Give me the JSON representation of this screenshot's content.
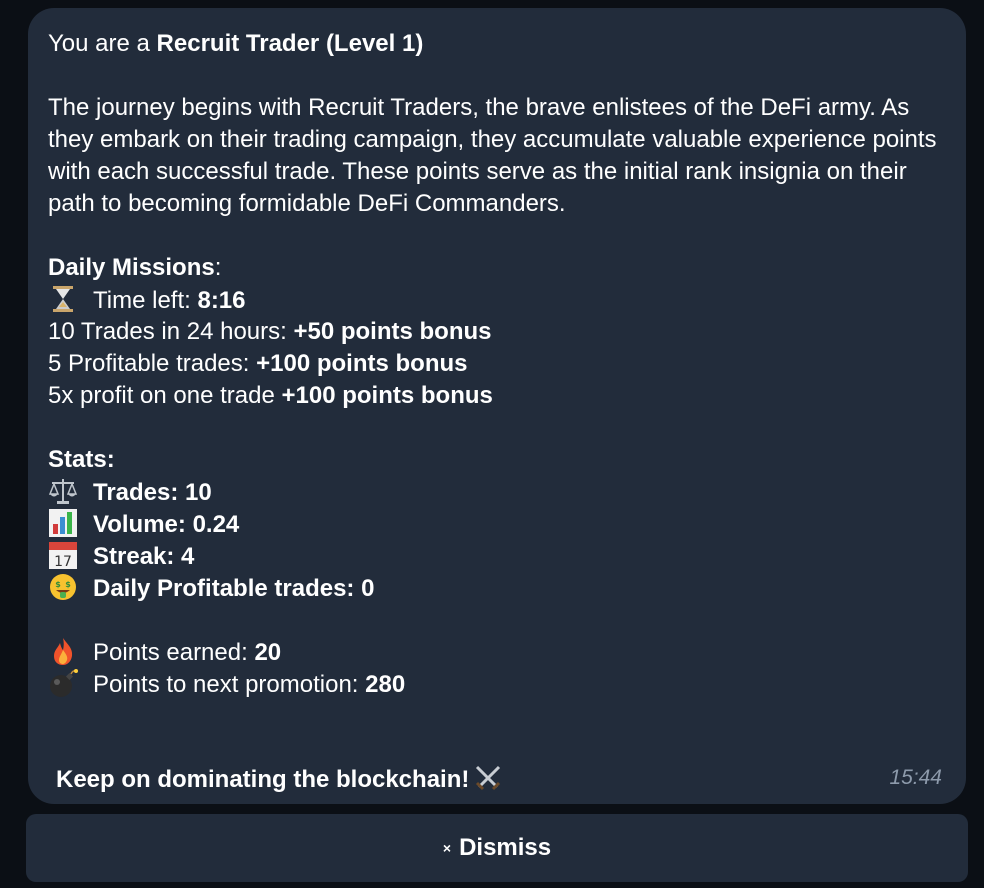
{
  "message": {
    "rank_prefix": "You are a ",
    "rank": "Recruit Trader (Level 1)",
    "description": "The journey begins with Recruit Traders, the brave enlistees of the DeFi army. As they embark on their trading campaign, they accumulate valuable experience points with each successful trade. These points serve as the initial rank insignia on their path to becoming formidable DeFi Commanders.",
    "missions_title": "Daily Missions",
    "missions_colon": ":",
    "time_left_label": "Time left: ",
    "time_left_value": "8:16",
    "missions": [
      {
        "label": "10 Trades in 24 hours: ",
        "bonus": "+50 points bonus"
      },
      {
        "label": "5 Profitable trades: ",
        "bonus": "+100 points bonus"
      },
      {
        "label": "5x profit on one trade ",
        "bonus": "+100 points bonus"
      }
    ],
    "stats_title": "Stats:",
    "stats": [
      {
        "icon": "scales-icon",
        "text": "Trades: 10"
      },
      {
        "icon": "bar-chart-icon",
        "text": "Volume: 0.24"
      },
      {
        "icon": "calendar-icon",
        "text": "Streak: 4"
      },
      {
        "icon": "money-face-icon",
        "text": "Daily Profitable trades: 0"
      }
    ],
    "points_earned_label": "Points earned: ",
    "points_earned_value": "20",
    "points_next_label": "Points to next promotion: ",
    "points_next_value": "280",
    "footer": "Keep on dominating the blockchain!",
    "timestamp": "15:44"
  },
  "dismiss": {
    "icon": "×",
    "label": "Dismiss"
  },
  "colors": {
    "bubble": "#222c3b",
    "background": "#0b0f15",
    "timestamp": "#8d9aab"
  }
}
